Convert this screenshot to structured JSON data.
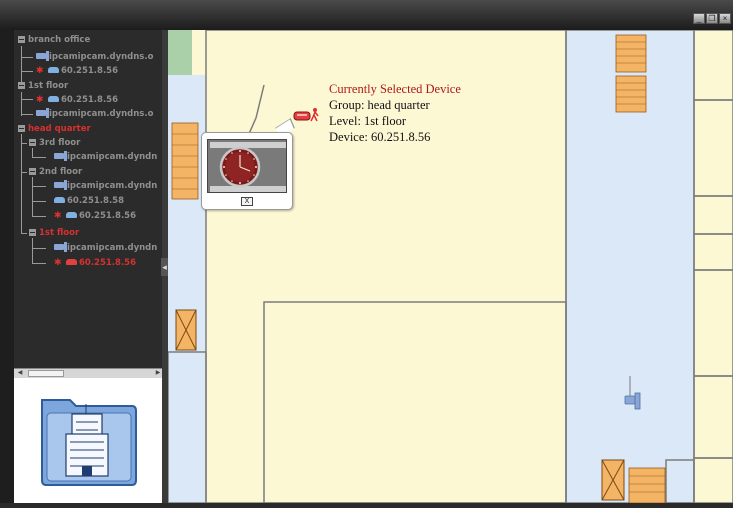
{
  "window": {
    "controls": [
      "_",
      "❐",
      "×"
    ]
  },
  "tree": {
    "items": [
      {
        "label": "branch office",
        "kind": "group",
        "state": "normal"
      },
      {
        "label": "ipcamipcam.dyndns.o",
        "kind": "camera",
        "state": "normal"
      },
      {
        "label": "60.251.8.56",
        "kind": "dvr",
        "state": "alarm"
      },
      {
        "label": "1st floor",
        "kind": "group",
        "state": "normal"
      },
      {
        "label": "60.251.8.56",
        "kind": "dvr",
        "state": "alarm"
      },
      {
        "label": "ipcamipcam.dyndns.o",
        "kind": "camera",
        "state": "normal"
      },
      {
        "label": "head quarter",
        "kind": "group",
        "state": "selected"
      },
      {
        "label": "3rd floor",
        "kind": "group",
        "state": "normal"
      },
      {
        "label": "ipcamipcam.dyndn",
        "kind": "camera",
        "state": "normal"
      },
      {
        "label": "2nd floor",
        "kind": "group",
        "state": "normal"
      },
      {
        "label": "ipcamipcam.dyndn",
        "kind": "camera",
        "state": "normal"
      },
      {
        "label": "60.251.8.58",
        "kind": "dvr",
        "state": "normal"
      },
      {
        "label": "60.251.8.56",
        "kind": "dvr",
        "state": "alarm"
      },
      {
        "label": "1st floor",
        "kind": "group",
        "state": "selected"
      },
      {
        "label": "ipcamipcam.dyndn",
        "kind": "camera",
        "state": "normal"
      },
      {
        "label": "60.251.8.56",
        "kind": "dvr",
        "state": "selected-alarm"
      }
    ]
  },
  "info": {
    "title": "Currently Selected Device",
    "group": "Group: head quarter",
    "level": "Level: 1st floor",
    "device": "Device: 60.251.8.56"
  },
  "popup": {
    "close_label": "X"
  },
  "icons": {
    "building": "building-icon",
    "camera": "camera-icon",
    "dvr": "dvr-icon",
    "alarm": "running-man-icon"
  },
  "colors": {
    "map_background": "#fcf8d4",
    "corridor": "#dbe8f7",
    "alert_text": "#b01818",
    "tree_background": "#2b2b2b",
    "tree_selected": "#d83030"
  }
}
